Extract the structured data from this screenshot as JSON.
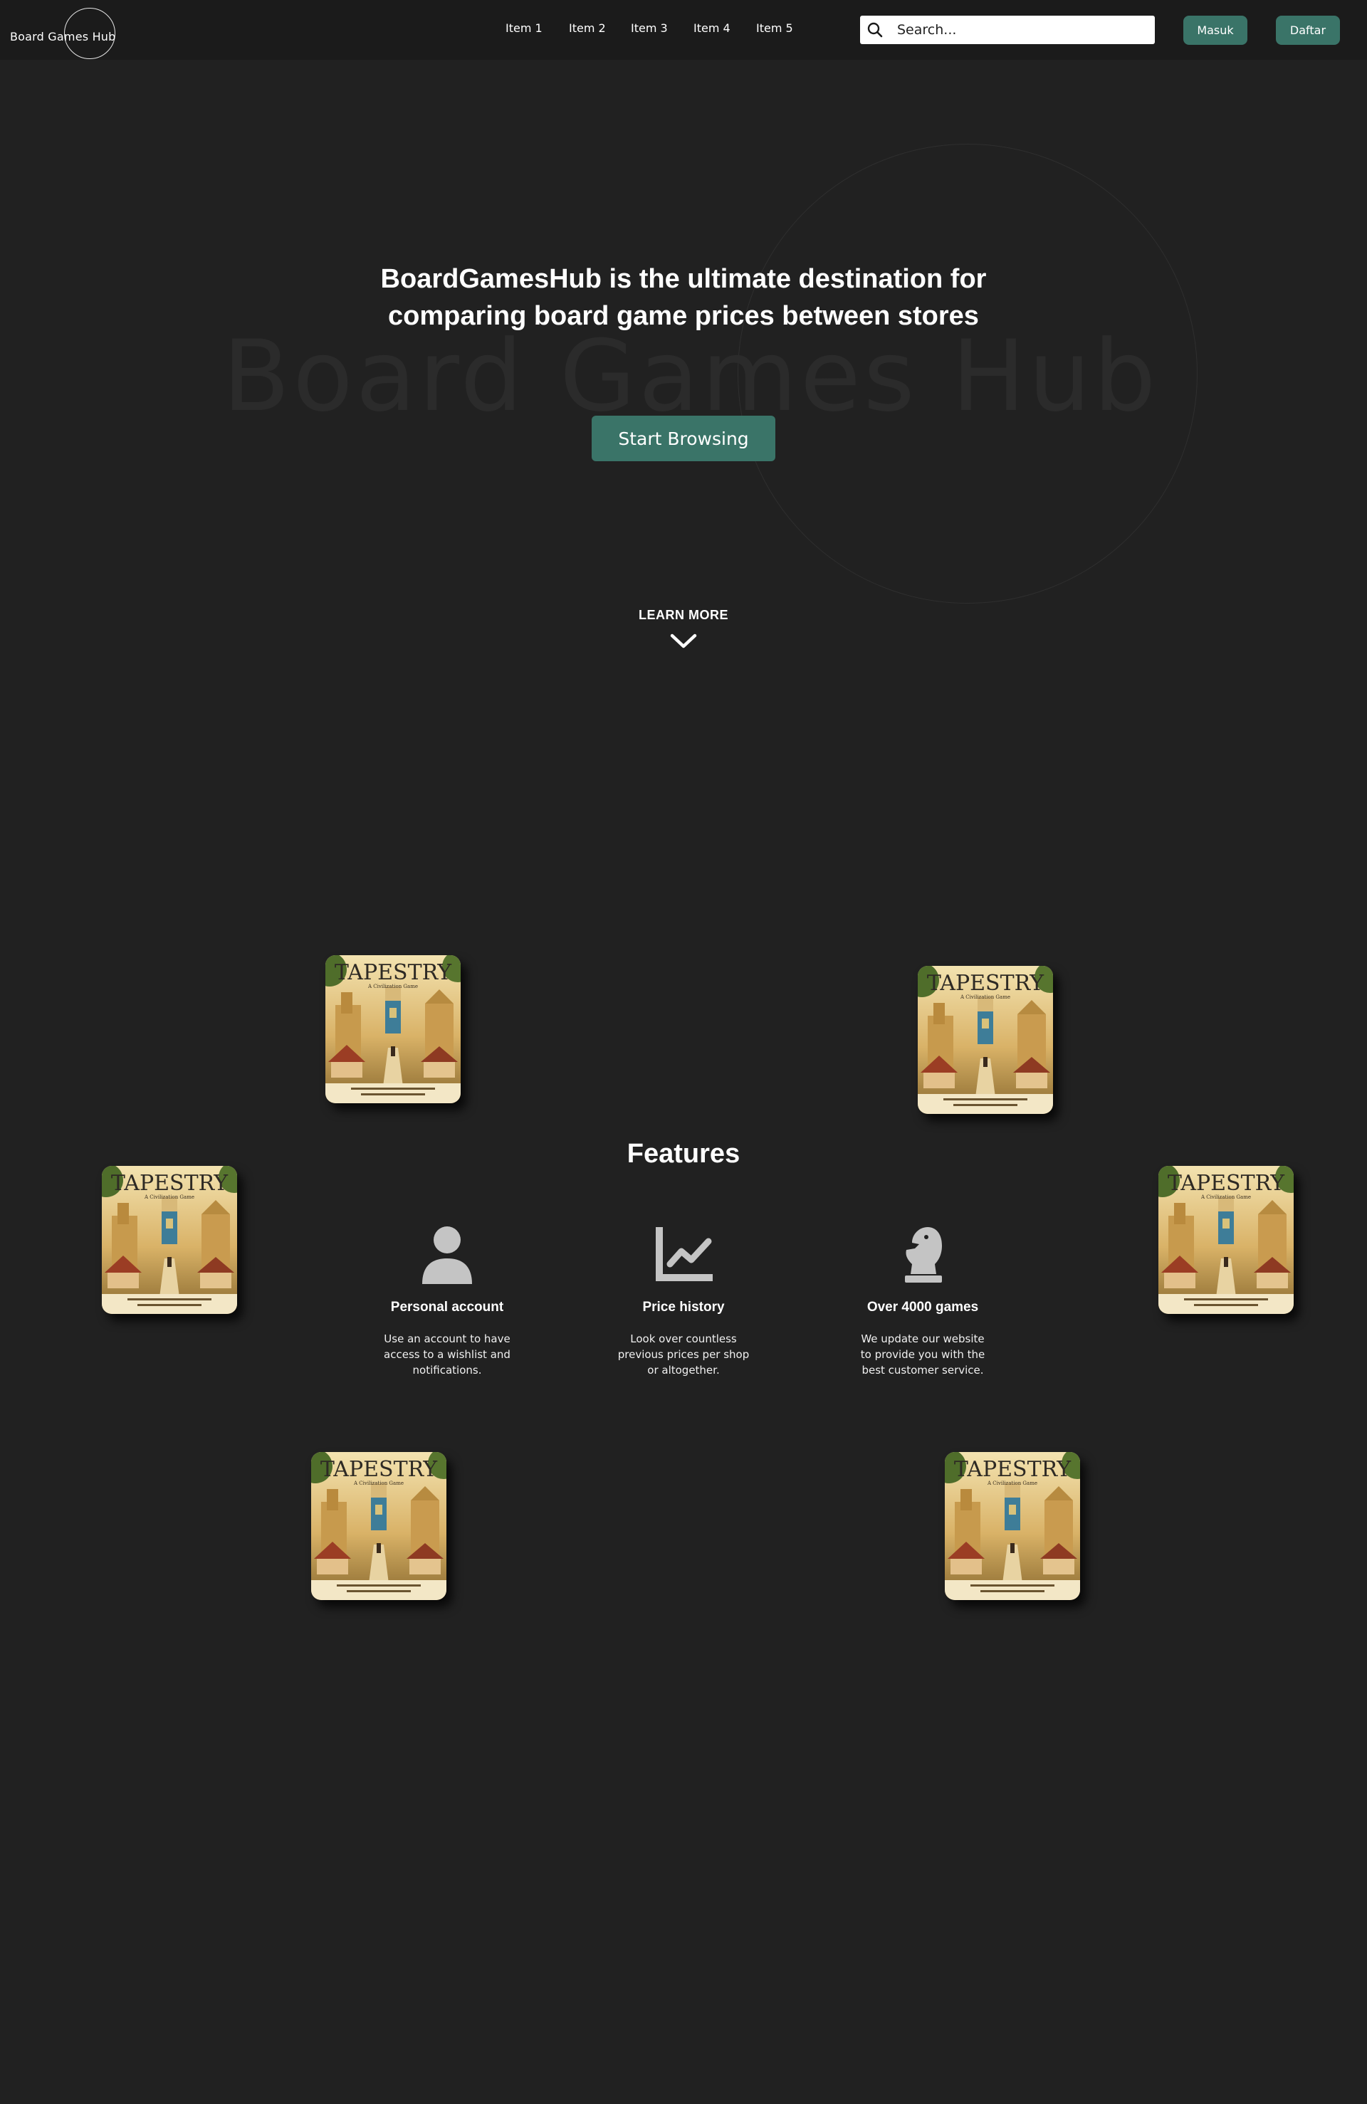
{
  "header": {
    "logo_text": "Board Games Hub",
    "nav_items": [
      "Item 1",
      "Item 2",
      "Item 3",
      "Item 4",
      "Item 5"
    ],
    "search": {
      "placeholder": "Search...",
      "icon": "search-icon"
    },
    "login_label": "Masuk",
    "register_label": "Daftar"
  },
  "hero": {
    "watermark": "Board Games Hub",
    "title": "BoardGamesHub is the ultimate destination for comparing board game prices between stores",
    "cta_label": "Start Browsing",
    "learn_more_label": "LEARN MORE",
    "learn_more_icon": "chevron-down-icon"
  },
  "covers": [
    {
      "title": "TAPESTRY",
      "subtitle": "A Civilization Game"
    },
    {
      "title": "TAPESTRY",
      "subtitle": "A Civilization Game"
    },
    {
      "title": "TAPESTRY",
      "subtitle": "A Civilization Game"
    },
    {
      "title": "TAPESTRY",
      "subtitle": "A Civilization Game"
    },
    {
      "title": "TAPESTRY",
      "subtitle": "A Civilization Game"
    },
    {
      "title": "TAPESTRY",
      "subtitle": "A Civilization Game"
    }
  ],
  "features": {
    "title": "Features",
    "items": [
      {
        "icon": "user-icon",
        "title": "Personal account",
        "description": "Use an account to have access to a wishlist and notifications."
      },
      {
        "icon": "chart-line-icon",
        "title": "Price history",
        "description": "Look over countless previous prices per shop or altogether."
      },
      {
        "icon": "chess-knight-icon",
        "title": "Over 4000 games",
        "description": "We update our website to provide you with the best customer service."
      }
    ]
  },
  "colors": {
    "background": "#212121",
    "header_background": "#1b1b1b",
    "accent": "#3a7468",
    "icon_gray": "#c4c4c4"
  }
}
